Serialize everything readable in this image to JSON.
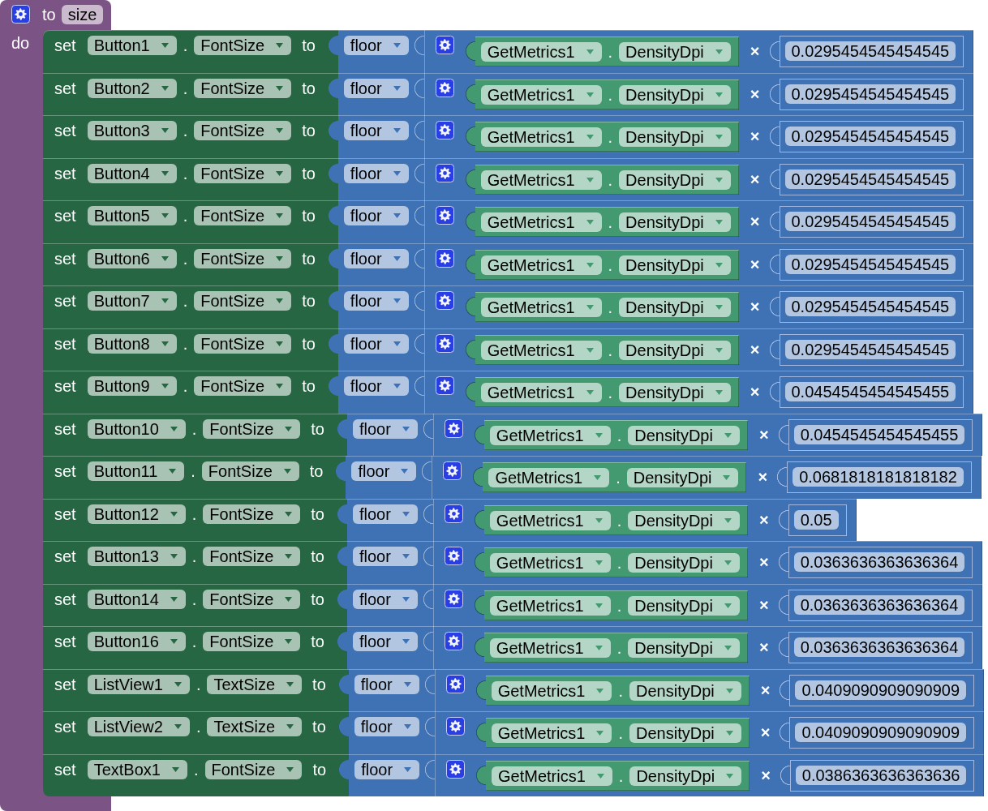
{
  "procedure": {
    "keyword": "to",
    "name": "size",
    "body_label": "do"
  },
  "statements": [
    {
      "keyword": "set",
      "component": "Button1",
      "separator": ".",
      "property": "FontSize",
      "connector": "to",
      "function": "floor",
      "multiply": {
        "getter": {
          "component": "GetMetrics1",
          "separator": ".",
          "property": "DensityDpi"
        },
        "operator": "×",
        "number": "0.0295454545454545"
      }
    },
    {
      "keyword": "set",
      "component": "Button2",
      "separator": ".",
      "property": "FontSize",
      "connector": "to",
      "function": "floor",
      "multiply": {
        "getter": {
          "component": "GetMetrics1",
          "separator": ".",
          "property": "DensityDpi"
        },
        "operator": "×",
        "number": "0.0295454545454545"
      }
    },
    {
      "keyword": "set",
      "component": "Button3",
      "separator": ".",
      "property": "FontSize",
      "connector": "to",
      "function": "floor",
      "multiply": {
        "getter": {
          "component": "GetMetrics1",
          "separator": ".",
          "property": "DensityDpi"
        },
        "operator": "×",
        "number": "0.0295454545454545"
      }
    },
    {
      "keyword": "set",
      "component": "Button4",
      "separator": ".",
      "property": "FontSize",
      "connector": "to",
      "function": "floor",
      "multiply": {
        "getter": {
          "component": "GetMetrics1",
          "separator": ".",
          "property": "DensityDpi"
        },
        "operator": "×",
        "number": "0.0295454545454545"
      }
    },
    {
      "keyword": "set",
      "component": "Button5",
      "separator": ".",
      "property": "FontSize",
      "connector": "to",
      "function": "floor",
      "multiply": {
        "getter": {
          "component": "GetMetrics1",
          "separator": ".",
          "property": "DensityDpi"
        },
        "operator": "×",
        "number": "0.0295454545454545"
      }
    },
    {
      "keyword": "set",
      "component": "Button6",
      "separator": ".",
      "property": "FontSize",
      "connector": "to",
      "function": "floor",
      "multiply": {
        "getter": {
          "component": "GetMetrics1",
          "separator": ".",
          "property": "DensityDpi"
        },
        "operator": "×",
        "number": "0.0295454545454545"
      }
    },
    {
      "keyword": "set",
      "component": "Button7",
      "separator": ".",
      "property": "FontSize",
      "connector": "to",
      "function": "floor",
      "multiply": {
        "getter": {
          "component": "GetMetrics1",
          "separator": ".",
          "property": "DensityDpi"
        },
        "operator": "×",
        "number": "0.0295454545454545"
      }
    },
    {
      "keyword": "set",
      "component": "Button8",
      "separator": ".",
      "property": "FontSize",
      "connector": "to",
      "function": "floor",
      "multiply": {
        "getter": {
          "component": "GetMetrics1",
          "separator": ".",
          "property": "DensityDpi"
        },
        "operator": "×",
        "number": "0.0295454545454545"
      }
    },
    {
      "keyword": "set",
      "component": "Button9",
      "separator": ".",
      "property": "FontSize",
      "connector": "to",
      "function": "floor",
      "multiply": {
        "getter": {
          "component": "GetMetrics1",
          "separator": ".",
          "property": "DensityDpi"
        },
        "operator": "×",
        "number": "0.0454545454545455"
      }
    },
    {
      "keyword": "set",
      "component": "Button10",
      "separator": ".",
      "property": "FontSize",
      "connector": "to",
      "function": "floor",
      "multiply": {
        "getter": {
          "component": "GetMetrics1",
          "separator": ".",
          "property": "DensityDpi"
        },
        "operator": "×",
        "number": "0.0454545454545455"
      }
    },
    {
      "keyword": "set",
      "component": "Button11",
      "separator": ".",
      "property": "FontSize",
      "connector": "to",
      "function": "floor",
      "multiply": {
        "getter": {
          "component": "GetMetrics1",
          "separator": ".",
          "property": "DensityDpi"
        },
        "operator": "×",
        "number": "0.0681818181818182"
      }
    },
    {
      "keyword": "set",
      "component": "Button12",
      "separator": ".",
      "property": "FontSize",
      "connector": "to",
      "function": "floor",
      "multiply": {
        "getter": {
          "component": "GetMetrics1",
          "separator": ".",
          "property": "DensityDpi"
        },
        "operator": "×",
        "number": "0.05"
      }
    },
    {
      "keyword": "set",
      "component": "Button13",
      "separator": ".",
      "property": "FontSize",
      "connector": "to",
      "function": "floor",
      "multiply": {
        "getter": {
          "component": "GetMetrics1",
          "separator": ".",
          "property": "DensityDpi"
        },
        "operator": "×",
        "number": "0.0363636363636364"
      }
    },
    {
      "keyword": "set",
      "component": "Button14",
      "separator": ".",
      "property": "FontSize",
      "connector": "to",
      "function": "floor",
      "multiply": {
        "getter": {
          "component": "GetMetrics1",
          "separator": ".",
          "property": "DensityDpi"
        },
        "operator": "×",
        "number": "0.0363636363636364"
      }
    },
    {
      "keyword": "set",
      "component": "Button16",
      "separator": ".",
      "property": "FontSize",
      "connector": "to",
      "function": "floor",
      "multiply": {
        "getter": {
          "component": "GetMetrics1",
          "separator": ".",
          "property": "DensityDpi"
        },
        "operator": "×",
        "number": "0.0363636363636364"
      }
    },
    {
      "keyword": "set",
      "component": "ListView1",
      "separator": ".",
      "property": "TextSize",
      "connector": "to",
      "function": "floor",
      "multiply": {
        "getter": {
          "component": "GetMetrics1",
          "separator": ".",
          "property": "DensityDpi"
        },
        "operator": "×",
        "number": "0.0409090909090909"
      }
    },
    {
      "keyword": "set",
      "component": "ListView2",
      "separator": ".",
      "property": "TextSize",
      "connector": "to",
      "function": "floor",
      "multiply": {
        "getter": {
          "component": "GetMetrics1",
          "separator": ".",
          "property": "DensityDpi"
        },
        "operator": "×",
        "number": "0.0409090909090909"
      }
    },
    {
      "keyword": "set",
      "component": "TextBox1",
      "separator": ".",
      "property": "FontSize",
      "connector": "to",
      "function": "floor",
      "multiply": {
        "getter": {
          "component": "GetMetrics1",
          "separator": ".",
          "property": "DensityDpi"
        },
        "operator": "×",
        "number": "0.0386363636363636"
      }
    }
  ]
}
